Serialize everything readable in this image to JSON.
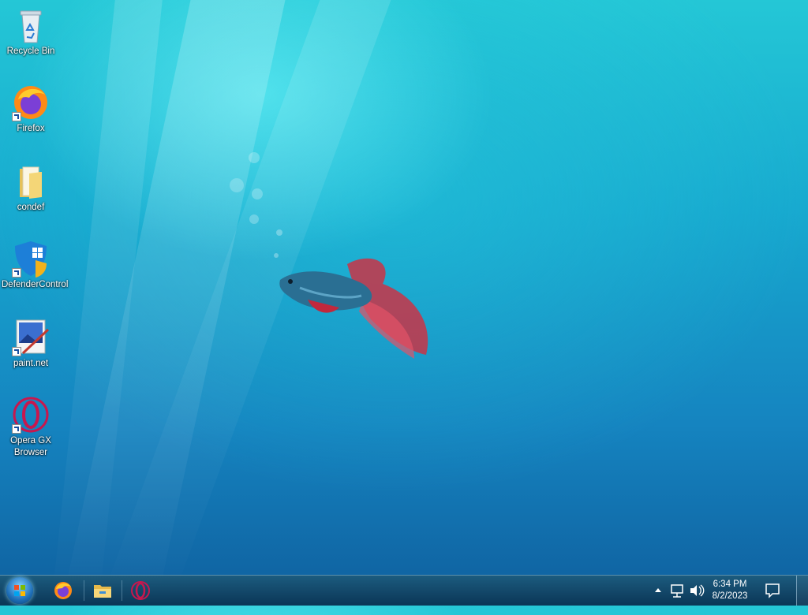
{
  "desktop": {
    "icons": [
      {
        "label": "Recycle Bin",
        "icon": "recycle-bin-icon"
      },
      {
        "label": "Firefox",
        "icon": "firefox-icon"
      },
      {
        "label": "condef",
        "icon": "folder-icon"
      },
      {
        "label": "DefenderControl",
        "icon": "defender-control-icon"
      },
      {
        "label": "paint.net",
        "icon": "paint-net-icon"
      },
      {
        "label": "Opera GX Browser",
        "icon": "opera-gx-icon"
      }
    ]
  },
  "taskbar": {
    "pinned": [
      "firefox-icon",
      "file-explorer-icon",
      "opera-gx-icon"
    ],
    "tray_icons": [
      "show-hidden-icons-icon",
      "network-icon",
      "volume-icon"
    ],
    "clock": {
      "time": "6:34 PM",
      "date": "8/2/2023"
    }
  },
  "colors": {
    "taskbar": "#1b5273",
    "accent_opera": "#c8174e"
  }
}
